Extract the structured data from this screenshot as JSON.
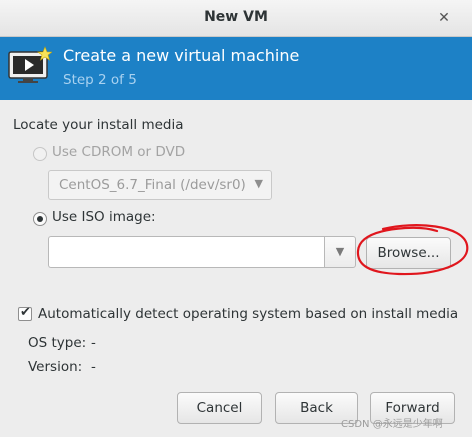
{
  "window": {
    "title": "New VM",
    "close_glyph": "✕"
  },
  "header": {
    "title": "Create a new virtual machine",
    "step": "Step 2 of 5",
    "icon": "vm-monitor-icon"
  },
  "install_media": {
    "section_label": "Locate your install media",
    "cdrom_option": {
      "label": "Use CDROM or DVD",
      "selected": false,
      "enabled": false
    },
    "cdrom_device": {
      "value": "CentOS_6.7_Final (/dev/sr0)",
      "enabled": false
    },
    "iso_option": {
      "label": "Use ISO image:",
      "selected": true
    },
    "iso_path": {
      "value": ""
    },
    "browse_label": "Browse..."
  },
  "os_detection": {
    "auto_detect_label": "Automatically detect operating system based on install media",
    "auto_detect_checked": true,
    "os_type_label": "OS type:",
    "os_type_value": "-",
    "version_label": "Version:",
    "version_value": "-"
  },
  "buttons": {
    "cancel": "Cancel",
    "back": "Back",
    "forward": "Forward"
  },
  "watermark": "CSDN @永远是少年啊",
  "colors": {
    "header_bg": "#1d81c6",
    "annotation": "#e0161d"
  }
}
